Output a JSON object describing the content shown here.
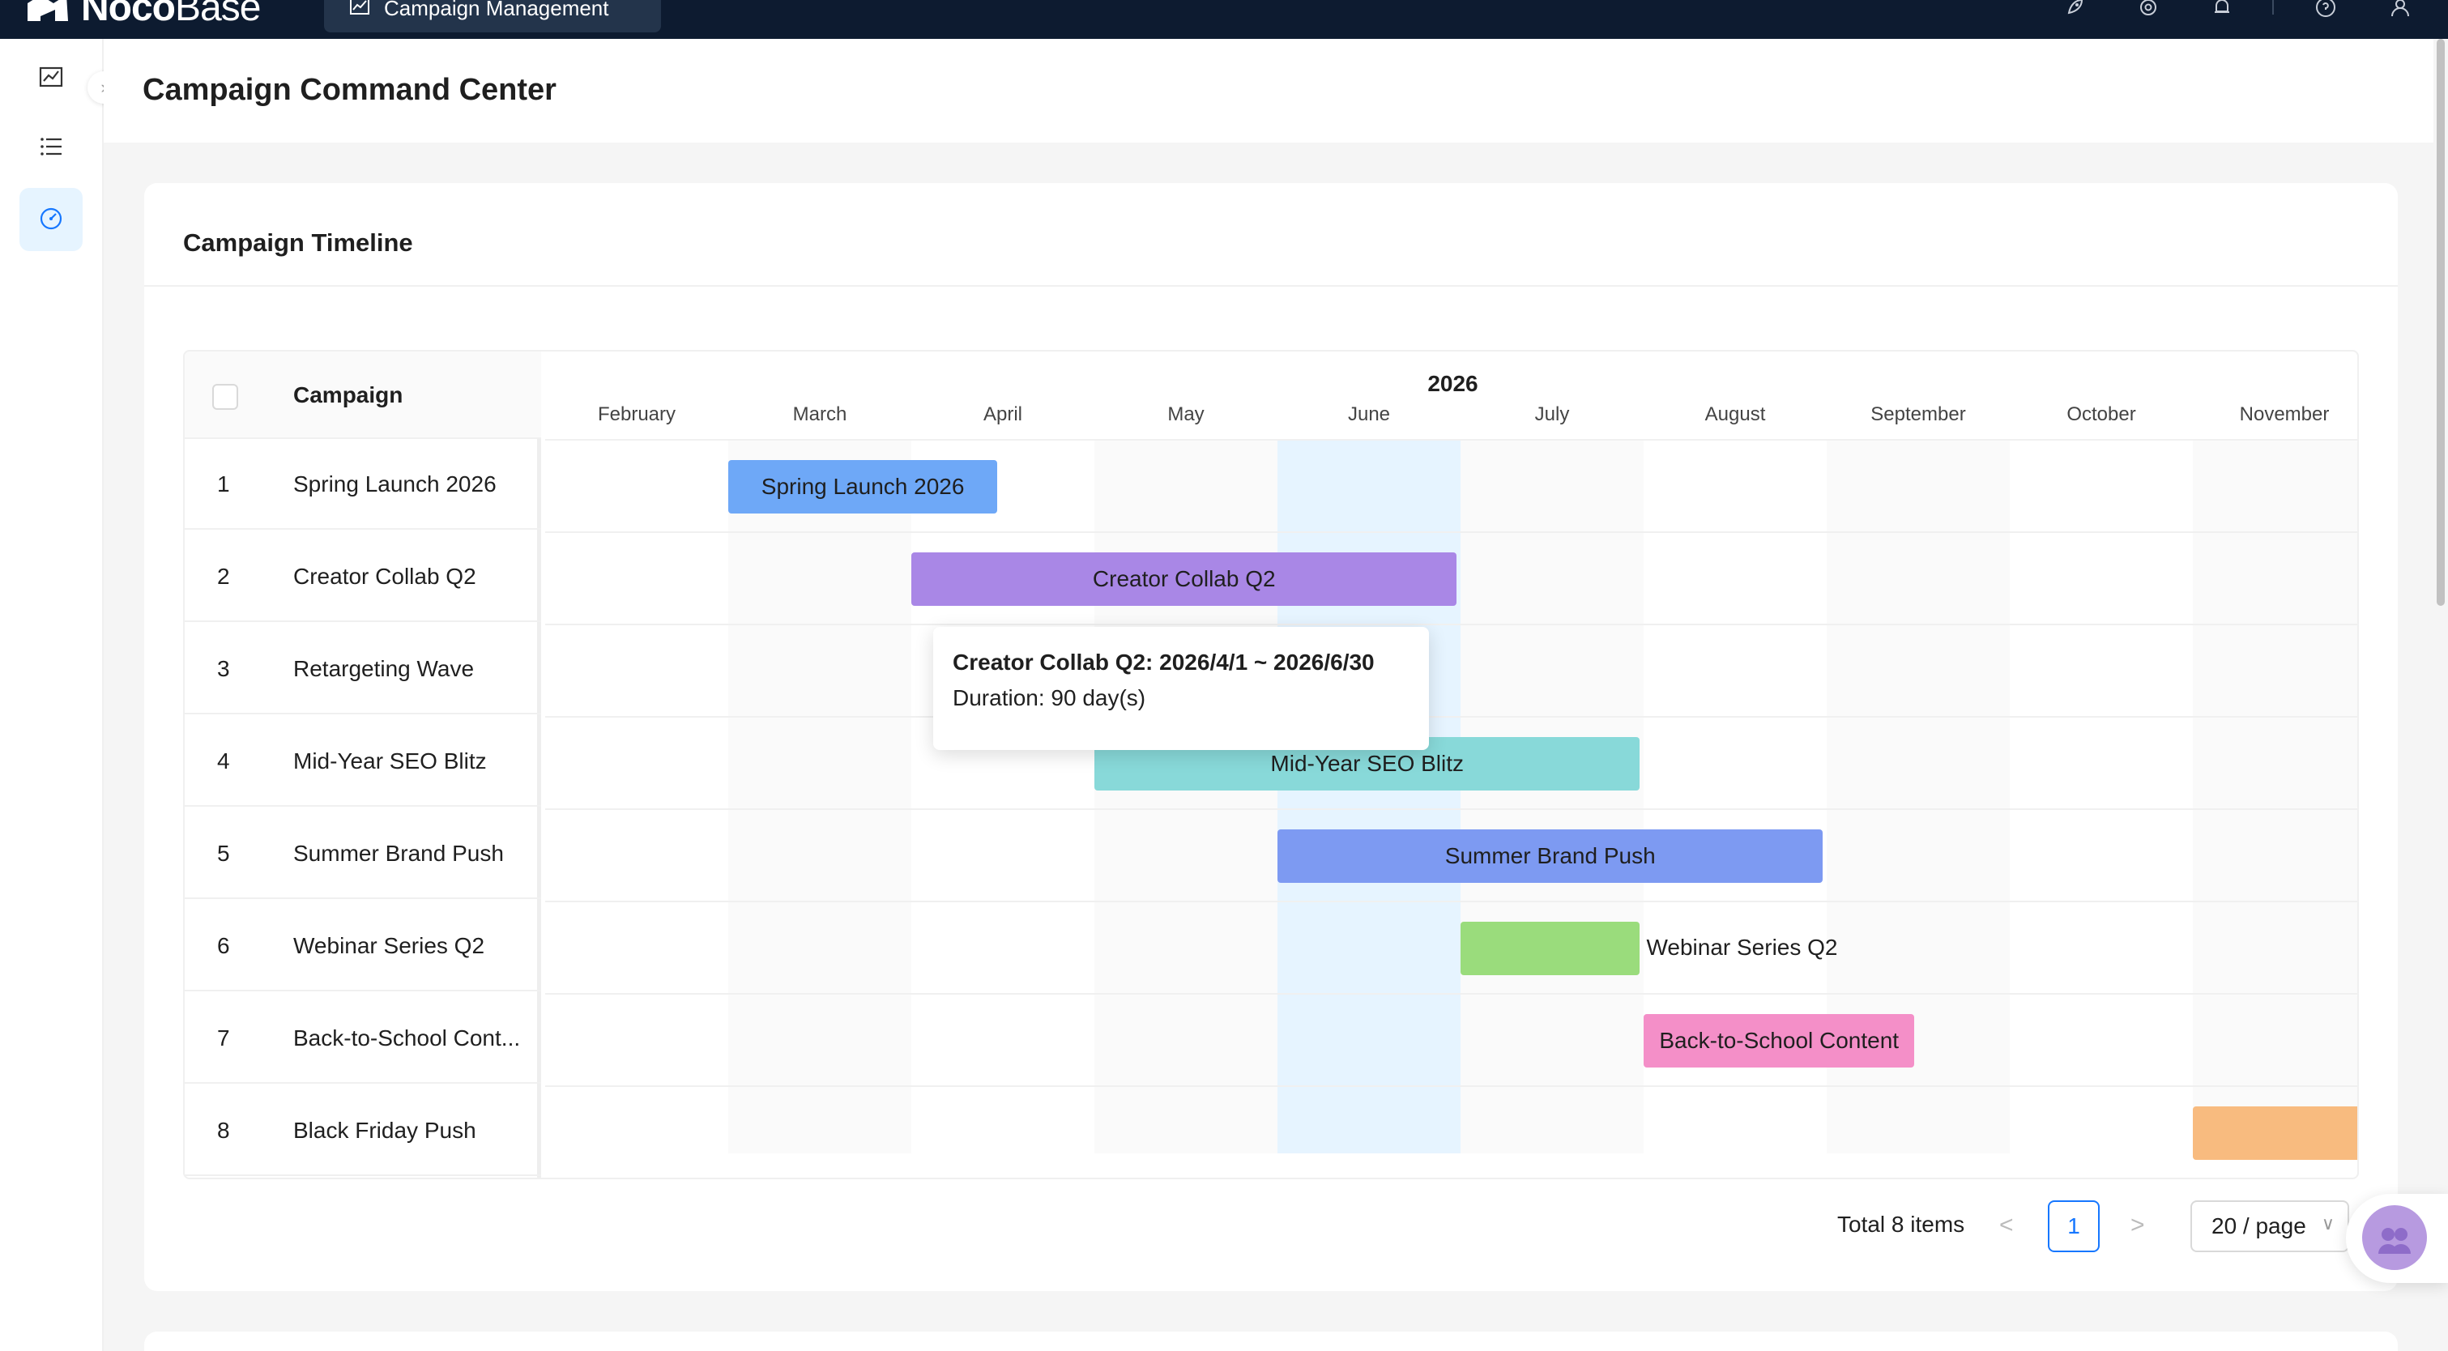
{
  "app": {
    "logo_bold": "Noco",
    "logo_thin": "Base",
    "active_tab_label": "Campaign Management",
    "top_icons": [
      "rocket-icon",
      "gear-icon",
      "bell-icon",
      "help-icon",
      "user-icon"
    ]
  },
  "sidenav": {
    "items": [
      {
        "icon": "chart-icon",
        "active": false
      },
      {
        "icon": "list-icon",
        "active": false
      },
      {
        "icon": "dashboard-icon",
        "active": true
      }
    ],
    "collapse_glyph": "›"
  },
  "page": {
    "title": "Campaign Command Center"
  },
  "card": {
    "title": "Campaign Timeline"
  },
  "gantt": {
    "column_header": "Campaign",
    "year": "2026",
    "months": [
      "February",
      "March",
      "April",
      "May",
      "June",
      "July",
      "August",
      "September",
      "October",
      "November"
    ],
    "today_month": "June",
    "rows": [
      {
        "num": "1",
        "name": "Spring Launch 2026",
        "bar_label": "Spring Launch 2026",
        "start_month_index": 1.0,
        "end_month_index": 2.47,
        "color": "#6ea8f7",
        "label_outside": false
      },
      {
        "num": "2",
        "name": "Creator Collab Q2",
        "bar_label": "Creator Collab Q2",
        "start_month_index": 2.0,
        "end_month_index": 4.98,
        "color": "#a987e6",
        "label_outside": false
      },
      {
        "num": "3",
        "name": "Retargeting Wave",
        "bar_label": "",
        "start_month_index": null,
        "end_month_index": null,
        "color": "",
        "label_outside": false
      },
      {
        "num": "4",
        "name": "Mid-Year SEO Blitz",
        "bar_label": "Mid-Year SEO Blitz",
        "start_month_index": 3.0,
        "end_month_index": 5.98,
        "color": "#88d9d9",
        "label_outside": false
      },
      {
        "num": "5",
        "name": "Summer Brand Push",
        "bar_label": "Summer Brand Push",
        "start_month_index": 4.0,
        "end_month_index": 6.98,
        "color": "#7d9af2",
        "label_outside": false
      },
      {
        "num": "6",
        "name": "Webinar Series Q2",
        "bar_label": "Webinar Series Q2",
        "start_month_index": 5.0,
        "end_month_index": 5.98,
        "color": "#9adc7c",
        "label_outside": true
      },
      {
        "num": "7",
        "name": "Back-to-School Cont...",
        "bar_label": "Back-to-School Content",
        "start_month_index": 6.0,
        "end_month_index": 7.48,
        "color": "#f48fc8",
        "label_outside": false
      },
      {
        "num": "8",
        "name": "Black Friday Push",
        "bar_label": "",
        "start_month_index": 9.0,
        "end_month_index": 10.0,
        "color": "#f8bb7f",
        "label_outside": false
      }
    ],
    "tooltip": {
      "title": "Creator Collab Q2: 2026/4/1 ~ 2026/6/30",
      "subtitle": "Duration: 90 day(s)"
    }
  },
  "pagination": {
    "total_text": "Total 8 items",
    "prev_glyph": "<",
    "current_page": "1",
    "next_glyph": ">",
    "page_size": "20 / page",
    "dropdown_glyph": "∨"
  }
}
